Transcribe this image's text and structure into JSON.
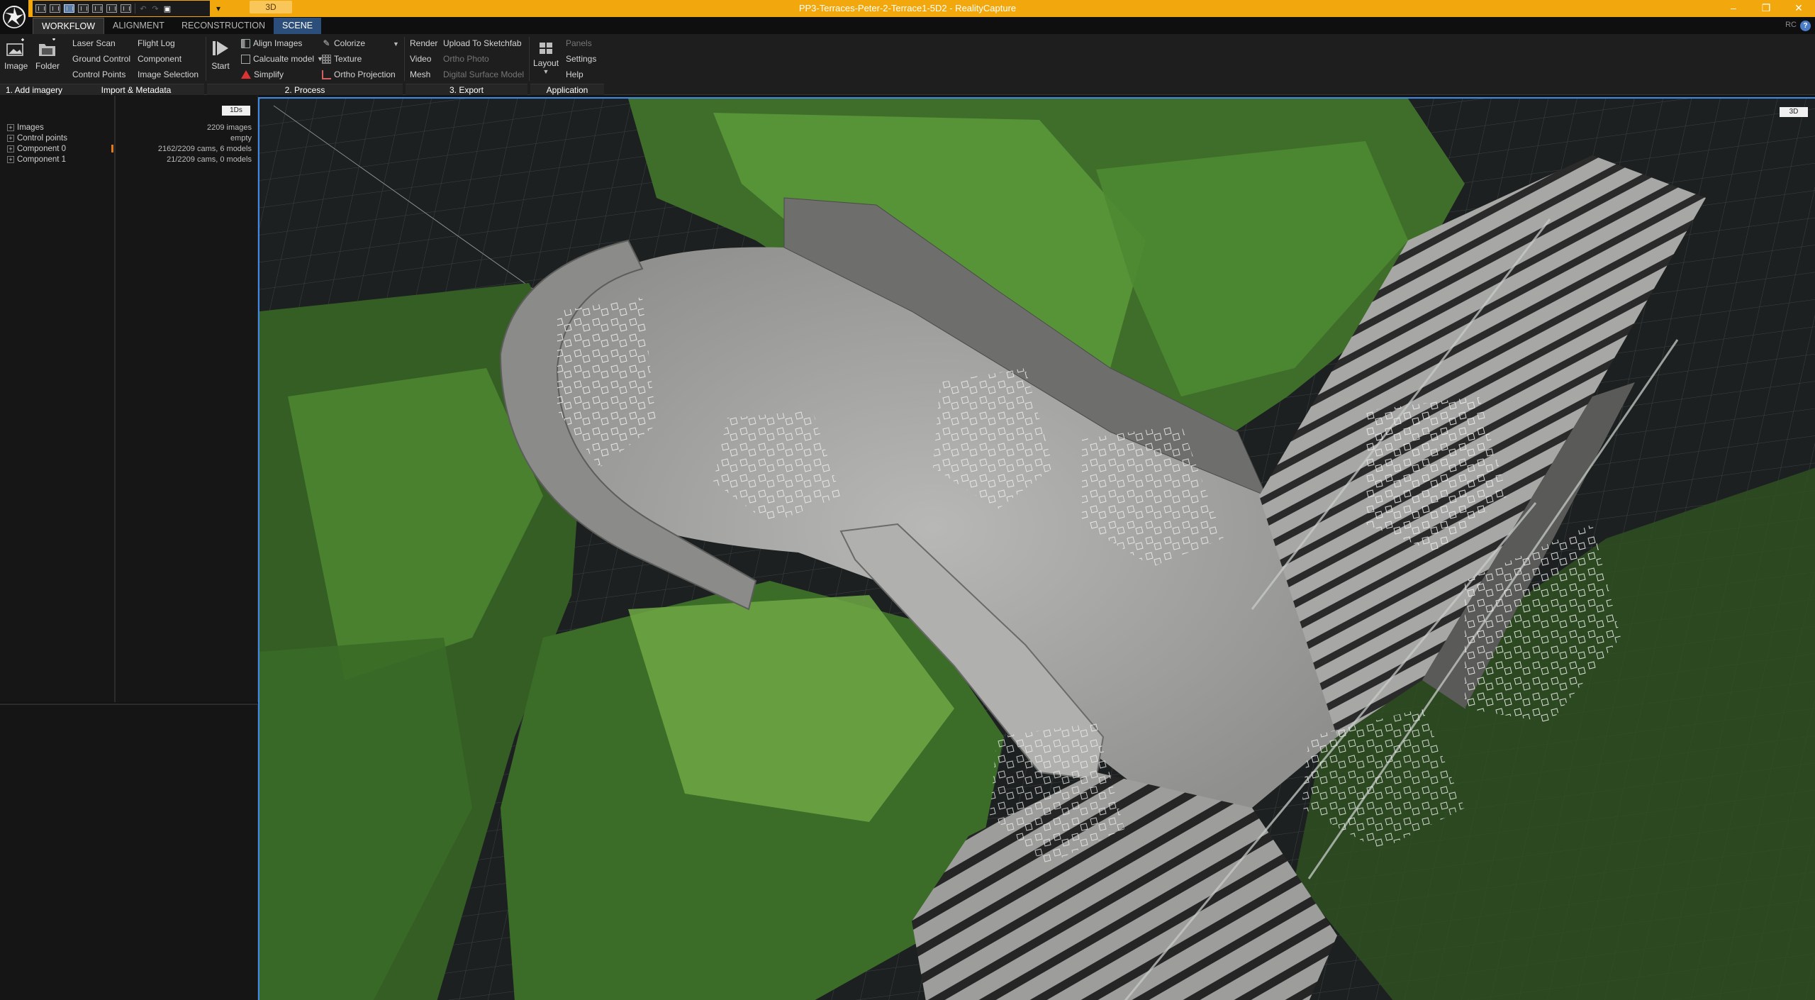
{
  "window": {
    "title": "PP3-Terraces-Peter-2-Terrace1-5D2 - RealityCapture",
    "mode_tab": "3D",
    "controls": [
      "–",
      "❐",
      "✕"
    ]
  },
  "tabs": [
    {
      "label": "WORKFLOW"
    },
    {
      "label": "ALIGNMENT"
    },
    {
      "label": "RECONSTRUCTION"
    },
    {
      "label": "SCENE"
    }
  ],
  "header_right": {
    "badge": "RC",
    "help": "?"
  },
  "ribbon": {
    "add_imagery": {
      "label": "1. Add imagery",
      "image": "Image",
      "folder": "Folder"
    },
    "import_metadata": {
      "label": "Import & Metadata",
      "laser_scan": "Laser Scan",
      "ground_control": "Ground Control",
      "control_points": "Control Points",
      "flight_log": "Flight Log",
      "component": "Component",
      "image_selection": "Image Selection"
    },
    "process": {
      "label": "2. Process",
      "start": "Start",
      "align_images": "Align Images",
      "calculate_model": "Calcualte model",
      "simplify": "Simplify",
      "colorize": "Colorize",
      "texture": "Texture",
      "ortho_projection": "Ortho Projection"
    },
    "export": {
      "label": "3. Export",
      "render": "Render",
      "video": "Video",
      "mesh": "Mesh",
      "upload_sketchfab": "Upload To Sketchfab",
      "ortho_photo": "Ortho Photo",
      "digital_surface_model": "Digital Surface Model"
    },
    "application": {
      "label": "Application",
      "layout": "Layout",
      "panels": "Panels",
      "settings": "Settings",
      "help": "Help"
    }
  },
  "panel_1ds": {
    "tag": "1Ds",
    "rows": [
      {
        "label": "Images",
        "value": "2209 images"
      },
      {
        "label": "Control points",
        "value": "empty"
      },
      {
        "label": "Component 0",
        "value": "2162/2209 cams, 6 models"
      },
      {
        "label": "Component 1",
        "value": "21/2209 cams, 0 models"
      }
    ]
  },
  "viewport": {
    "tag": "3D"
  },
  "colors": {
    "titlebar": "#f2a80c",
    "scene_tab": "#2c4e7a",
    "viewport_border": "#3e8ae6",
    "marker": "#e07a1a",
    "foliage": "#4f8a33",
    "stone": "#9a9a98"
  }
}
